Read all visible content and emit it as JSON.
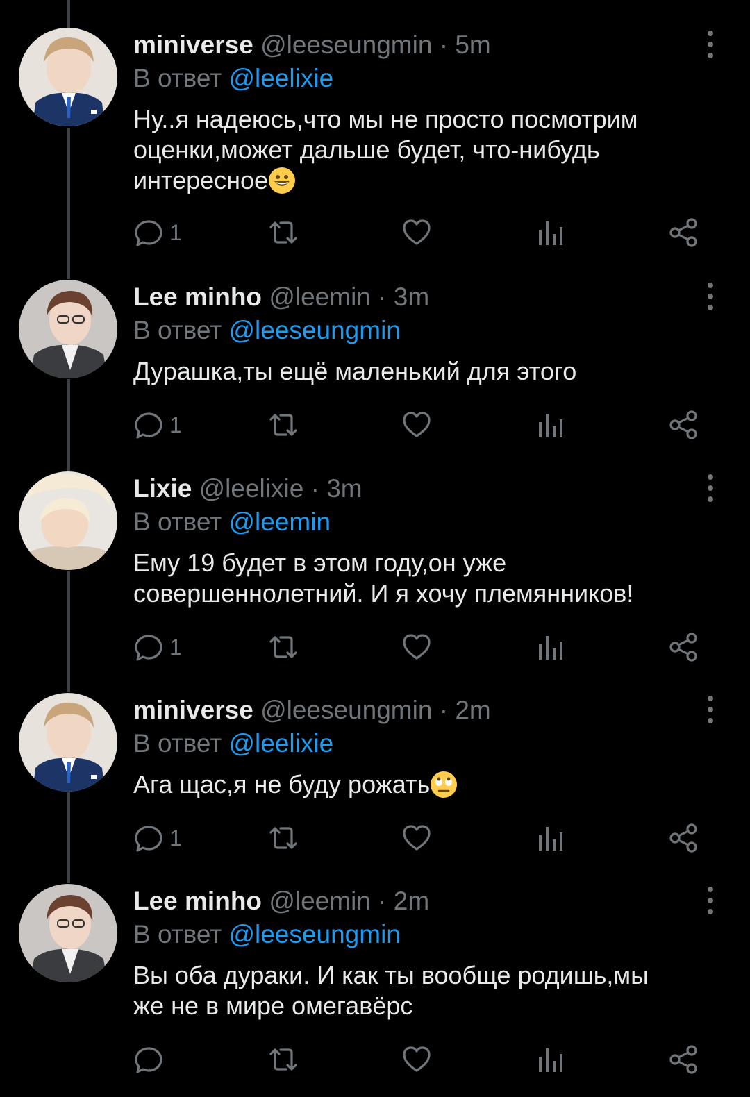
{
  "colors": {
    "background": "#000000",
    "primary_text": "#e7e9ea",
    "secondary_text": "#71767b",
    "mention": "#1d9bf0",
    "thread_line": "#3e4144"
  },
  "tweets": [
    {
      "display_name": "miniverse",
      "handle": "@leeseungmin",
      "separator": "·",
      "time": "5m",
      "reply_prefix": "В ответ",
      "reply_to": "@leelixie",
      "text_lines": [
        "Ну..я надеюсь,что мы не просто посмотрим",
        "оценки,может дальше будет, что-нибудь",
        "интересное"
      ],
      "emoji": "grinning-face",
      "reply_count": "1",
      "avatar": "avatar-seungmin"
    },
    {
      "display_name": "Lee minho",
      "handle": "@leemin",
      "separator": "·",
      "time": "3m",
      "reply_prefix": "В ответ",
      "reply_to": "@leeseungmin",
      "text_lines": [
        "Дурашка,ты ещё маленький для этого"
      ],
      "emoji": "",
      "reply_count": "1",
      "avatar": "avatar-minho"
    },
    {
      "display_name": "Lixie",
      "handle": "@leelixie",
      "separator": "·",
      "time": "3m",
      "reply_prefix": "В ответ",
      "reply_to": "@leemin",
      "text_lines": [
        "Ему 19 будет в этом году,он уже",
        "совершеннолетний. И я хочу племянников!"
      ],
      "emoji": "",
      "reply_count": "1",
      "avatar": "avatar-lixie"
    },
    {
      "display_name": "miniverse",
      "handle": "@leeseungmin",
      "separator": "·",
      "time": "2m",
      "reply_prefix": "В ответ",
      "reply_to": "@leelixie",
      "text_lines": [
        "Ага щас,я не буду рожать"
      ],
      "emoji": "eye-roll-face",
      "reply_count": "1",
      "avatar": "avatar-seungmin"
    },
    {
      "display_name": "Lee minho",
      "handle": "@leemin",
      "separator": "·",
      "time": "2m",
      "reply_prefix": "В ответ",
      "reply_to": "@leeseungmin",
      "text_lines": [
        "Вы оба дураки. И как ты вообще родишь,мы",
        "же не в мире омегавёрс"
      ],
      "emoji": "",
      "reply_count": "",
      "avatar": "avatar-minho"
    }
  ],
  "icons": [
    "reply-icon",
    "retweet-icon",
    "like-icon",
    "analytics-icon",
    "share-icon",
    "more-options-icon"
  ]
}
